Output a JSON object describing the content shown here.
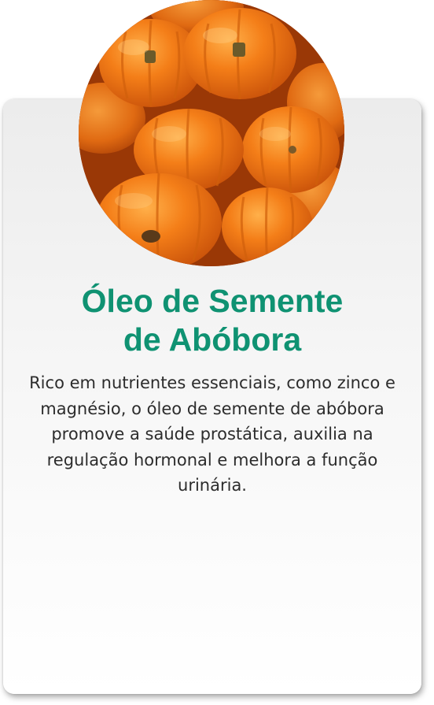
{
  "card": {
    "title_line1": "Óleo de Semente",
    "title_line2": "de Abóbora",
    "description": "Rico em nutrientes essenciais, como zinco e magnésio, o óleo de semente de abóbora promove a saúde prostática, auxilia na regulação hormonal e melhora a função urinária.",
    "photo": "pumpkins-photo",
    "colors": {
      "title": "#0f9272",
      "text": "#2c2c2c",
      "pumpkin": "#f07a17"
    }
  }
}
